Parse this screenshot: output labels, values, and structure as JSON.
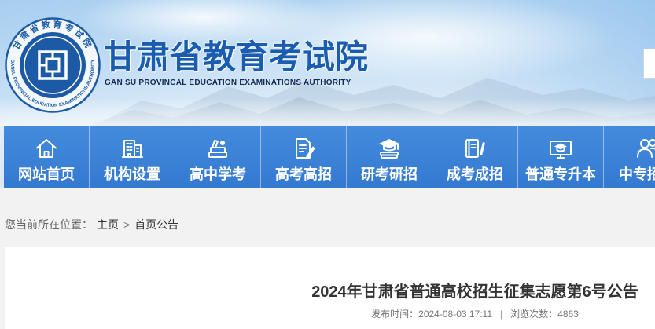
{
  "header": {
    "title": "甘肃省教育考试院",
    "subtitle": "GAN SU PROVINCAL EDUCATION EXAMINATIONS AUTHORITY",
    "logo": {
      "icon": "exam-authority-seal",
      "text_cn": "甘肃省教育考试院",
      "text_en": "GANSU PROVINCIAL EDUCATION EXAMINATIONS AUTHORITY"
    }
  },
  "nav": {
    "items": [
      {
        "label": "网站首页",
        "icon": "home-icon"
      },
      {
        "label": "机构设置",
        "icon": "building-icon"
      },
      {
        "label": "高中学考",
        "icon": "books-icon"
      },
      {
        "label": "高考高招",
        "icon": "document-pen-icon"
      },
      {
        "label": "研考研招",
        "icon": "graduation-cap-icon"
      },
      {
        "label": "成考成招",
        "icon": "book-pen-icon"
      },
      {
        "label": "普通专升本",
        "icon": "monitor-cap-icon"
      },
      {
        "label": "中专招",
        "icon": "people-icon"
      }
    ]
  },
  "breadcrumb": {
    "prefix": "您当前所在位置：",
    "items": [
      "主页",
      "首页公告"
    ],
    "separator": ">"
  },
  "article": {
    "title": "2024年甘肃省普通高校招生征集志愿第6号公告",
    "published_label": "发布时间：",
    "published_at": "2024-08-03 17:11",
    "divider": "|",
    "views_label": "浏览次数：",
    "views": "4863"
  },
  "colors": {
    "nav_background": "#3a80d5",
    "site_title": "#1a5cb0",
    "page_background": "#f2f2f2"
  }
}
